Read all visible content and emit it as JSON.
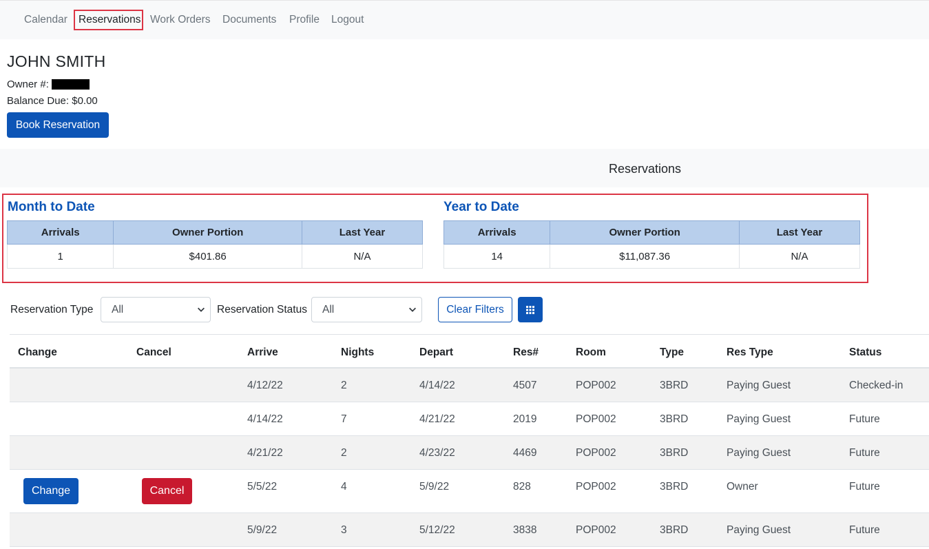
{
  "nav": {
    "items": [
      {
        "label": "Calendar"
      },
      {
        "label": "Reservations"
      },
      {
        "label": "Work Orders"
      },
      {
        "label": "Documents"
      },
      {
        "label": "Profile"
      },
      {
        "label": "Logout"
      }
    ],
    "active": "Reservations"
  },
  "owner": {
    "name": "JOHN SMITH",
    "owner_number_label": "Owner #:",
    "balance_label": "Balance Due:",
    "balance_value": "$0.00",
    "book_button": "Book Reservation"
  },
  "section_title": "Reservations",
  "summary": {
    "month": {
      "title": "Month to Date",
      "headers": [
        "Arrivals",
        "Owner Portion",
        "Last Year"
      ],
      "values": [
        "1",
        "$401.86",
        "N/A"
      ]
    },
    "year": {
      "title": "Year to Date",
      "headers": [
        "Arrivals",
        "Owner Portion",
        "Last Year"
      ],
      "values": [
        "14",
        "$11,087.36",
        "N/A"
      ]
    }
  },
  "filters": {
    "type_label": "Reservation Type",
    "type_value": "All",
    "status_label": "Reservation Status",
    "status_value": "All",
    "clear_button": "Clear Filters",
    "grid_icon": "grid-icon"
  },
  "table": {
    "headers": [
      "Change",
      "Cancel",
      "Arrive",
      "Nights",
      "Depart",
      "Res#",
      "Room",
      "Type",
      "Res Type",
      "Status"
    ],
    "rows": [
      {
        "change": "",
        "cancel": "",
        "arrive": "4/12/22",
        "nights": "2",
        "depart": "4/14/22",
        "res": "4507",
        "room": "POP002",
        "type": "3BRD",
        "res_type": "Paying Guest",
        "status": "Checked-in"
      },
      {
        "change": "",
        "cancel": "",
        "arrive": "4/14/22",
        "nights": "7",
        "depart": "4/21/22",
        "res": "2019",
        "room": "POP002",
        "type": "3BRD",
        "res_type": "Paying Guest",
        "status": "Future"
      },
      {
        "change": "",
        "cancel": "",
        "arrive": "4/21/22",
        "nights": "2",
        "depart": "4/23/22",
        "res": "4469",
        "room": "POP002",
        "type": "3BRD",
        "res_type": "Paying Guest",
        "status": "Future"
      },
      {
        "change": "Change",
        "cancel": "Cancel",
        "arrive": "5/5/22",
        "nights": "4",
        "depart": "5/9/22",
        "res": "828",
        "room": "POP002",
        "type": "3BRD",
        "res_type": "Owner",
        "status": "Future"
      },
      {
        "change": "",
        "cancel": "",
        "arrive": "5/9/22",
        "nights": "3",
        "depart": "5/12/22",
        "res": "3838",
        "room": "POP002",
        "type": "3BRD",
        "res_type": "Paying Guest",
        "status": "Future"
      }
    ]
  },
  "colors": {
    "primary": "#0d55b6",
    "danger": "#c8192f",
    "highlight_border": "#dc3545",
    "summary_header_bg": "#b8cfec"
  }
}
